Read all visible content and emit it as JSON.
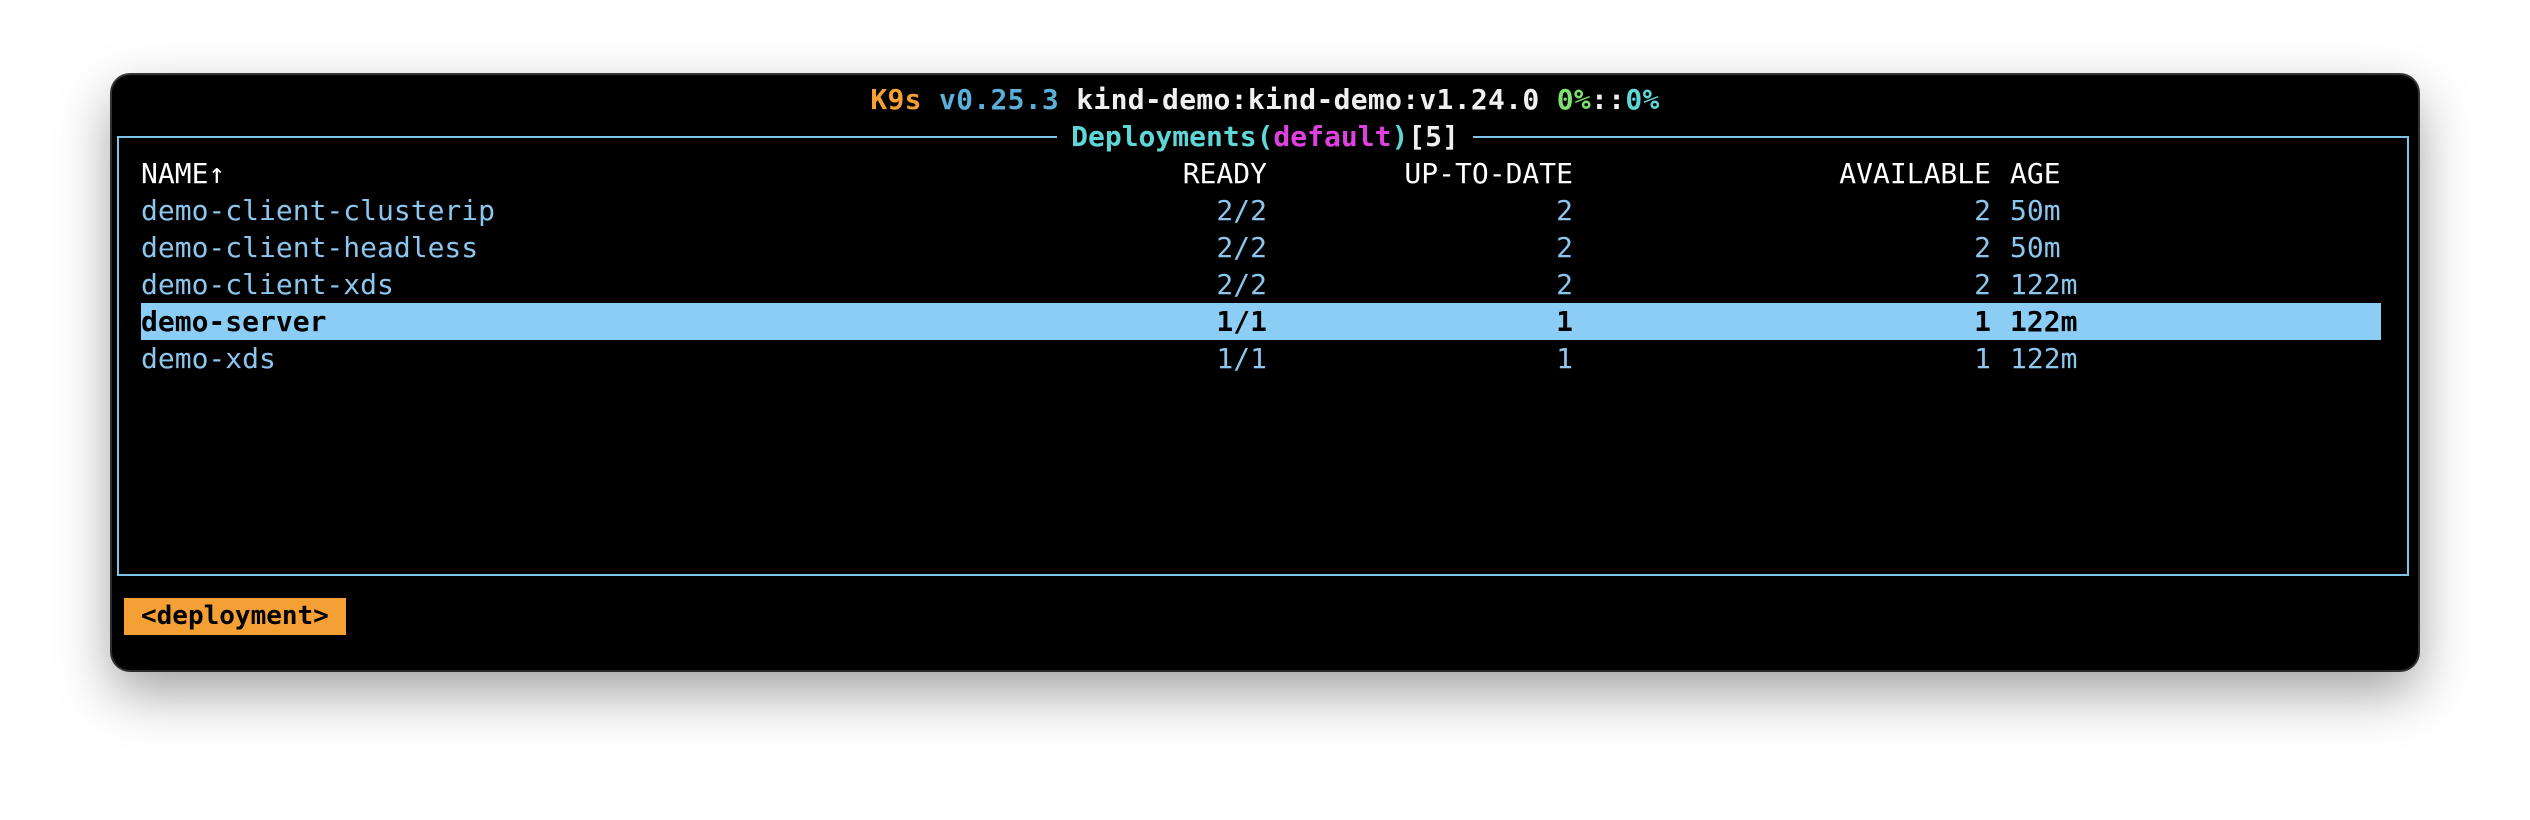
{
  "header": {
    "app": "K9s",
    "version": "v0.25.3",
    "context": "kind-demo:kind-demo:v1.24.0",
    "cpu": "0%",
    "separator": "::",
    "mem": "0%"
  },
  "view": {
    "resource": "Deployments",
    "paren_open": "(",
    "namespace": "default",
    "paren_close": ")",
    "count": "[5]"
  },
  "table": {
    "columns": [
      "NAME↑",
      "READY",
      "UP-TO-DATE",
      "AVAILABLE",
      "AGE"
    ],
    "rows": [
      {
        "name": "demo-client-clusterip",
        "ready": "2/2",
        "uptodate": "2",
        "available": "2",
        "age": "50m"
      },
      {
        "name": "demo-client-headless",
        "ready": "2/2",
        "uptodate": "2",
        "available": "2",
        "age": "50m"
      },
      {
        "name": "demo-client-xds",
        "ready": "2/2",
        "uptodate": "2",
        "available": "2",
        "age": "122m"
      },
      {
        "name": "demo-server",
        "ready": "1/1",
        "uptodate": "1",
        "available": "1",
        "age": "122m"
      },
      {
        "name": "demo-xds",
        "ready": "1/1",
        "uptodate": "1",
        "available": "1",
        "age": "122m"
      }
    ],
    "selected_index": 3
  },
  "breadcrumb": "<deployment>",
  "colors": {
    "border": "#7ec3ea",
    "selection": "#8ccdf5",
    "crumb": "#f5a035",
    "accent_orange": "#f5a035",
    "accent_magenta": "#e040e0"
  }
}
